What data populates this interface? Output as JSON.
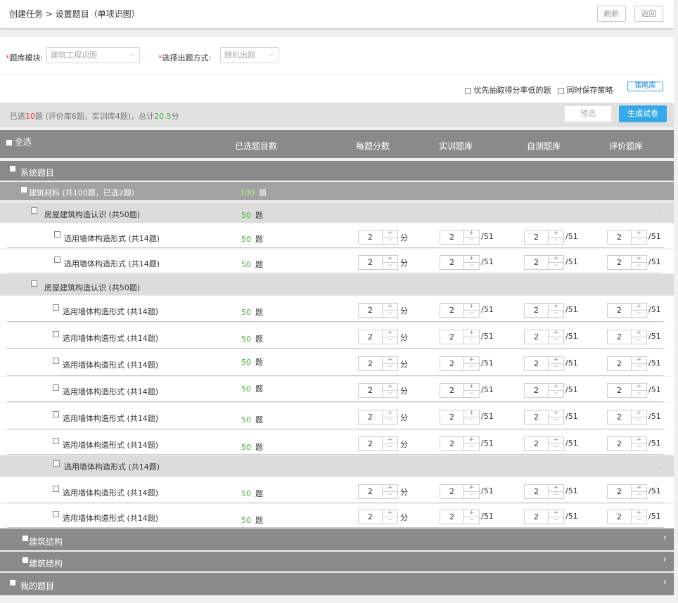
{
  "header": {
    "breadcrumb": "创建任务 > 设置题目（单项识图）",
    "refresh": "刷新",
    "back": "返回"
  },
  "filters": {
    "module_label": "题库模块:",
    "module_value": "建筑工程识图",
    "method_label": "选择出题方式:",
    "method_value": "随机出题",
    "opt_low_score": "优先抽取得分率低的题",
    "opt_save_strategy": "同时保存策略",
    "strategy_lib": "策略库"
  },
  "summary": {
    "p1": "已选",
    "selected": "10",
    "p2": "题 (评价库6题，实训库4题)，总计",
    "total": "20.5",
    "p3": "分",
    "preview": "预选",
    "generate": "生成试卷"
  },
  "columns": {
    "select_all": "全选",
    "selected_count": "已选题目数",
    "score": "每题分数",
    "train": "实训题库",
    "self_test": "自测题库",
    "eval": "评价题库"
  },
  "tree": {
    "system": "系统题目",
    "material": "建筑材料  (共100题，已选2题)",
    "material_count": "100",
    "unit": "题",
    "cat1": "房屋建筑构造认识      (共50题)",
    "cat1_count": "50",
    "cat2": "房屋建筑构造认识      (共50题)",
    "sub": "选用墙体构造形式  (共14题)",
    "sub_count": "50",
    "sp_value": "2",
    "plus": "+",
    "minus": "−",
    "score_unit": "分",
    "bank_total": "/51",
    "structure1": "建筑结构",
    "structure2": "建筑结构",
    "mine": "我的题目"
  }
}
